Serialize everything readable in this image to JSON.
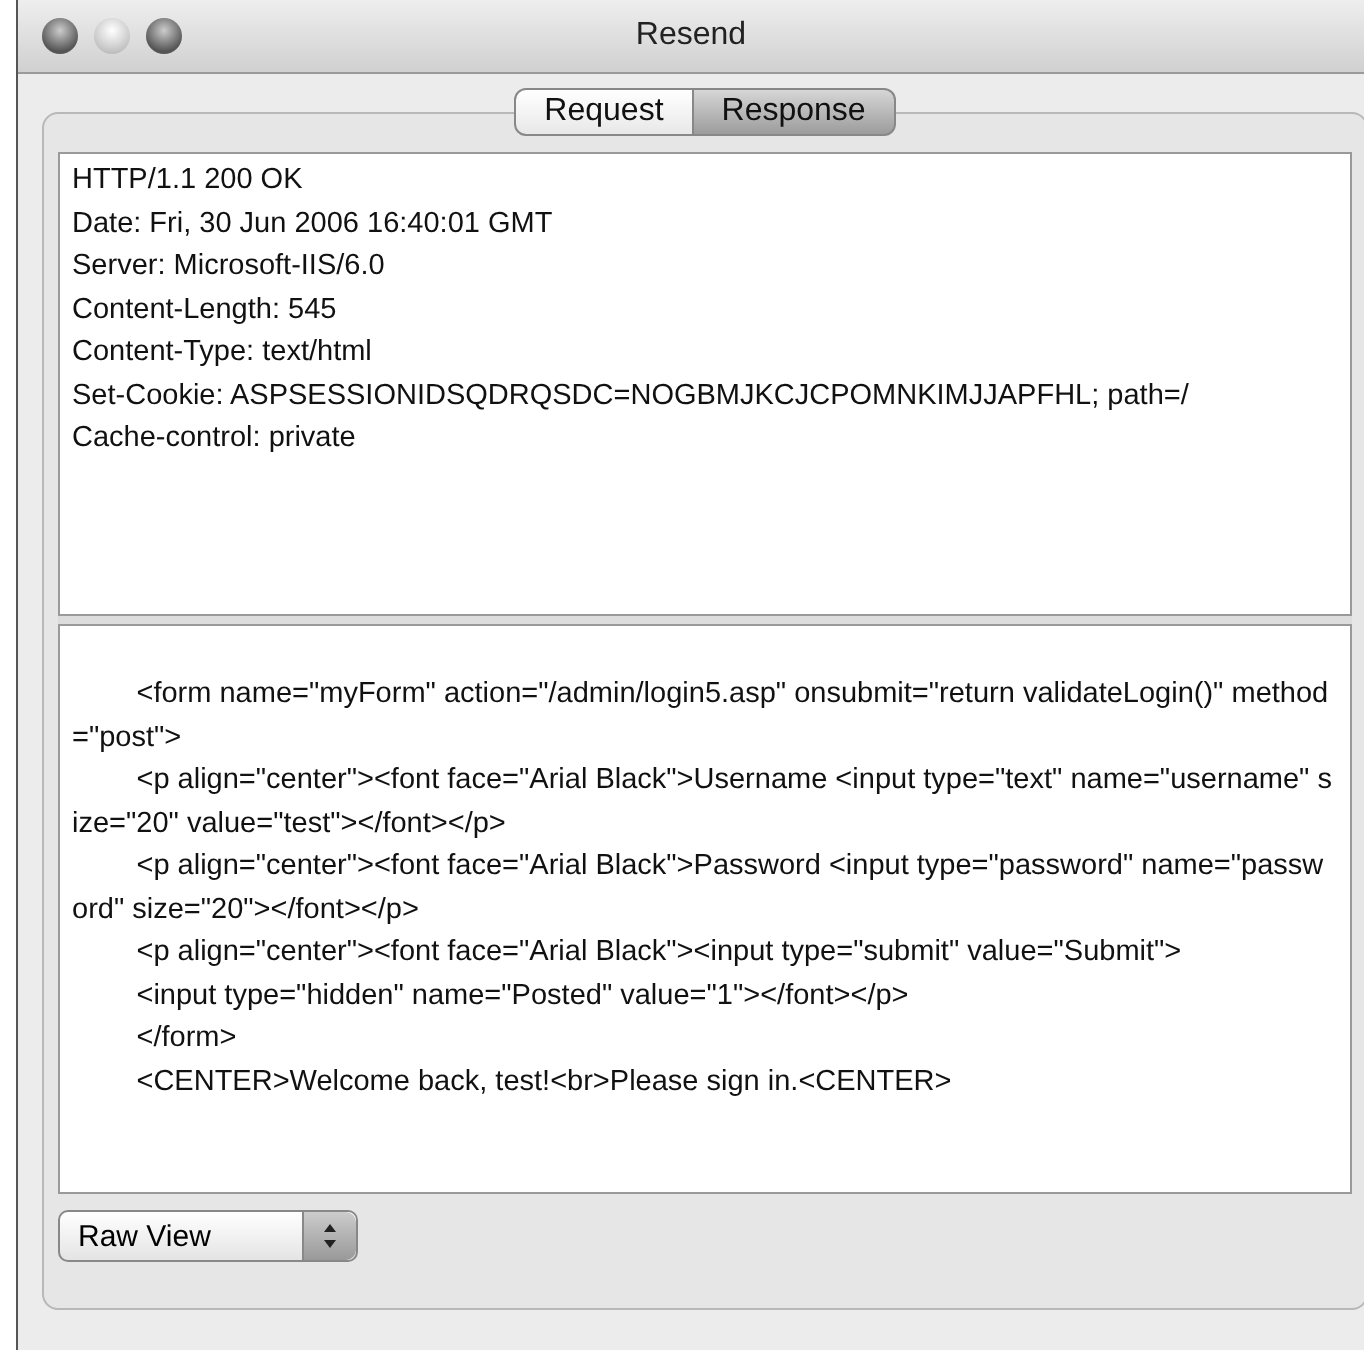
{
  "window": {
    "title": "Resend"
  },
  "tabs": [
    {
      "label": "Request",
      "selected": false
    },
    {
      "label": "Response",
      "selected": true
    }
  ],
  "headers_pane": {
    "lines": [
      "HTTP/1.1 200 OK",
      "Date: Fri, 30 Jun 2006 16:40:01 GMT",
      "Server: Microsoft-IIS/6.0",
      "Content-Length: 545",
      "Content-Type: text/html",
      "Set-Cookie: ASPSESSIONIDSQDRQSDC=NOGBMJKCJCPOMNKIMJJAPFHL; path=/",
      "Cache-control: private"
    ]
  },
  "body_pane": {
    "lines": [
      "\t<form name=\"myForm\" action=\"/admin/login5.asp\" onsubmit=\"return validateLogin()\" method=\"post\">",
      "\t<p align=\"center\"><font face=\"Arial Black\">Username <input type=\"text\" name=\"username\" size=\"20\" value=\"test\"></font></p>",
      "\t<p align=\"center\"><font face=\"Arial Black\">Password <input type=\"password\" name=\"password\" size=\"20\"></font></p>",
      "\t<p align=\"center\"><font face=\"Arial Black\"><input type=\"submit\" value=\"Submit\">",
      "\t<input type=\"hidden\" name=\"Posted\" value=\"1\"></font></p>",
      "\t</form>",
      "\t<CENTER>Welcome back, test!<br>Please sign in.<CENTER>"
    ]
  },
  "view_popup": {
    "value": "Raw View"
  }
}
